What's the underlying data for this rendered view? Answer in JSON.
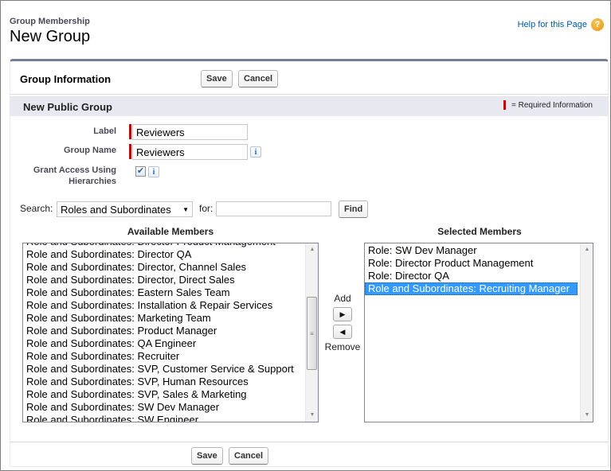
{
  "header": {
    "breadcrumb": "Group Membership",
    "title": "New Group",
    "help_link": "Help for this Page",
    "help_icon": "question-circle-icon"
  },
  "panel": {
    "title": "Group Information",
    "save_label": "Save",
    "cancel_label": "Cancel"
  },
  "section": {
    "title": "New Public Group",
    "required_legend": "= Required Information"
  },
  "form": {
    "label_field": {
      "label": "Label",
      "value": "Reviewers",
      "required": true
    },
    "group_name_field": {
      "label": "Group Name",
      "value": "Reviewers",
      "required": true,
      "info_icon": "i"
    },
    "grant_access": {
      "label_line1": "Grant Access Using",
      "label_line2": "Hierarchies",
      "checked": true,
      "check_glyph": "✔",
      "info_icon": "i"
    }
  },
  "search": {
    "label": "Search:",
    "selected": "Roles and Subordinates",
    "for_label": "for:",
    "query": "",
    "find_label": "Find"
  },
  "available": {
    "header": "Available Members",
    "items": [
      "Role and Subordinates: Director Product Management",
      "Role and Subordinates: Director QA",
      "Role and Subordinates: Director, Channel Sales",
      "Role and Subordinates: Director, Direct Sales",
      "Role and Subordinates: Eastern Sales Team",
      "Role and Subordinates: Installation & Repair Services",
      "Role and Subordinates: Marketing Team",
      "Role and Subordinates: Product Manager",
      "Role and Subordinates: QA Engineer",
      "Role and Subordinates: Recruiter",
      "Role and Subordinates: SVP, Customer Service & Support",
      "Role and Subordinates: SVP, Human Resources",
      "Role and Subordinates: SVP, Sales & Marketing",
      "Role and Subordinates: SW Dev Manager",
      "Role and Subordinates: SW Engineer"
    ]
  },
  "move": {
    "add_label": "Add",
    "add_glyph": "▶",
    "remove_glyph": "◀",
    "remove_label": "Remove"
  },
  "selected": {
    "header": "Selected Members",
    "items": [
      "Role: SW Dev Manager",
      "Role: Director Product Management",
      "Role: Director QA",
      "Role and Subordinates: Recruiting Manager"
    ],
    "selected_index": 3
  },
  "footer": {
    "save_label": "Save",
    "cancel_label": "Cancel"
  },
  "glyphs": {
    "dropdown": "▼",
    "scroll_up": "▲",
    "scroll_down": "▼",
    "thumb_grip": "≡"
  }
}
